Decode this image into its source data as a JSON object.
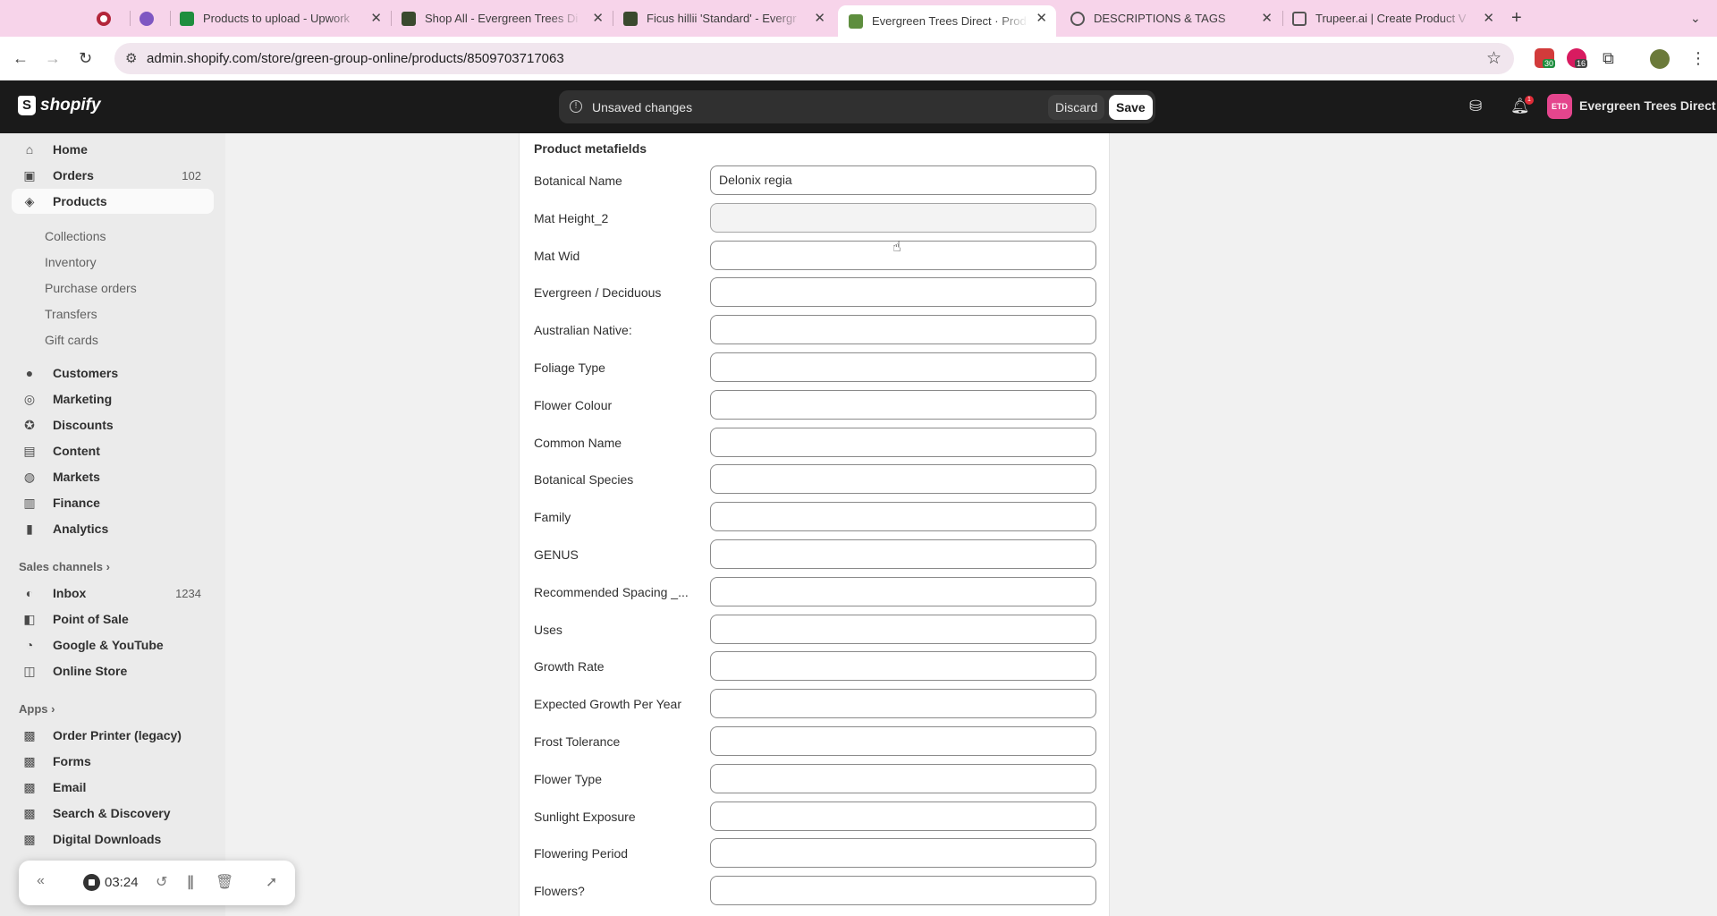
{
  "browser": {
    "tabs": [
      {
        "title": "",
        "active": false
      },
      {
        "title": "",
        "active": false
      },
      {
        "title": "Products to upload - Upwork",
        "active": false
      },
      {
        "title": "Shop All - Evergreen Trees Di",
        "active": false
      },
      {
        "title": "Ficus hillii 'Standard' - Evergr",
        "active": false
      },
      {
        "title": "Evergreen Trees Direct · Prod",
        "active": true
      },
      {
        "title": "DESCRIPTIONS & TAGS",
        "active": false
      },
      {
        "title": "Trupeer.ai | Create Product V",
        "active": false
      }
    ],
    "url": "admin.shopify.com/store/green-group-online/products/8509703717063",
    "ext_badge_1": "30",
    "ext_badge_2": "16"
  },
  "topbar": {
    "logo_text": "shopify",
    "unsaved_text": "Unsaved changes",
    "discard_label": "Discard",
    "save_label": "Save",
    "notification_count": "1",
    "store_initials": "ETD",
    "store_name": "Evergreen Trees Direct"
  },
  "sidebar": {
    "main": [
      {
        "label": "Home",
        "icon": "home-icon"
      },
      {
        "label": "Orders",
        "icon": "orders-icon",
        "badge": "102"
      },
      {
        "label": "Products",
        "icon": "tag-icon",
        "active": true
      }
    ],
    "product_sub": [
      "Collections",
      "Inventory",
      "Purchase orders",
      "Transfers",
      "Gift cards"
    ],
    "secondary": [
      {
        "label": "Customers",
        "icon": "person-icon"
      },
      {
        "label": "Marketing",
        "icon": "target-icon"
      },
      {
        "label": "Discounts",
        "icon": "discount-icon"
      },
      {
        "label": "Content",
        "icon": "content-icon"
      },
      {
        "label": "Markets",
        "icon": "globe-icon"
      },
      {
        "label": "Finance",
        "icon": "bank-icon"
      },
      {
        "label": "Analytics",
        "icon": "chart-icon"
      }
    ],
    "sales_channels_header": "Sales channels",
    "channels": [
      {
        "label": "Inbox",
        "badge": "1234"
      },
      {
        "label": "Point of Sale"
      },
      {
        "label": "Google & YouTube"
      },
      {
        "label": "Online Store"
      }
    ],
    "apps_header": "Apps",
    "apps": [
      "Order Printer (legacy)",
      "Forms",
      "Email",
      "Search & Discovery",
      "Digital Downloads"
    ]
  },
  "metafields": {
    "title": "Product metafields",
    "fields": [
      {
        "label": "Botanical Name",
        "value": "Delonix regia"
      },
      {
        "label": "Mat Height_2",
        "value": ""
      },
      {
        "label": "Mat Wid",
        "value": ""
      },
      {
        "label": "Evergreen / Deciduous",
        "value": ""
      },
      {
        "label": "Australian Native:",
        "value": ""
      },
      {
        "label": "Foliage Type",
        "value": ""
      },
      {
        "label": "Flower Colour",
        "value": ""
      },
      {
        "label": "Common Name",
        "value": ""
      },
      {
        "label": "Botanical Species",
        "value": ""
      },
      {
        "label": "Family",
        "value": ""
      },
      {
        "label": "GENUS",
        "value": ""
      },
      {
        "label": "Recommended Spacing _...",
        "value": ""
      },
      {
        "label": "Uses",
        "value": ""
      },
      {
        "label": "Growth Rate",
        "value": ""
      },
      {
        "label": "Expected Growth Per Year",
        "value": ""
      },
      {
        "label": "Frost Tolerance",
        "value": ""
      },
      {
        "label": "Flower Type",
        "value": ""
      },
      {
        "label": "Sunlight Exposure",
        "value": ""
      },
      {
        "label": "Flowering Period",
        "value": ""
      },
      {
        "label": "Flowers?",
        "value": ""
      }
    ]
  },
  "recorder": {
    "time": "03:24"
  }
}
